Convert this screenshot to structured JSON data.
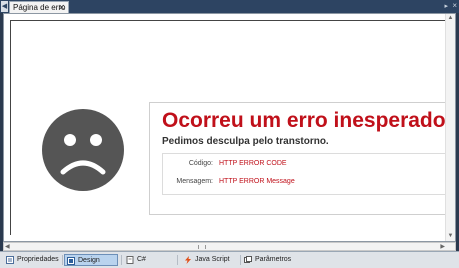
{
  "tabs": {
    "document_tab": "Página de erro",
    "close_glyph": "✕"
  },
  "error": {
    "title": "Ocorreu um erro inesperado!",
    "subtitle": "Pedimos desculpa pelo transtorno.",
    "rows": [
      {
        "label": "Código:",
        "value": "HTTP ERROR CODE"
      },
      {
        "label": "Mensagem:",
        "value": "HTTP ERROR Message"
      }
    ],
    "accent_color": "#c0101a"
  },
  "bottom_tabs": [
    {
      "label": "Propriedades",
      "icon": "properties-icon"
    },
    {
      "label": "Design",
      "icon": "design-icon",
      "active": true
    },
    {
      "label": "C#",
      "icon": "csharp-file-icon"
    },
    {
      "label": "Java Script",
      "icon": "javascript-icon"
    },
    {
      "label": "Parâmetros",
      "icon": "parameters-icon"
    }
  ]
}
